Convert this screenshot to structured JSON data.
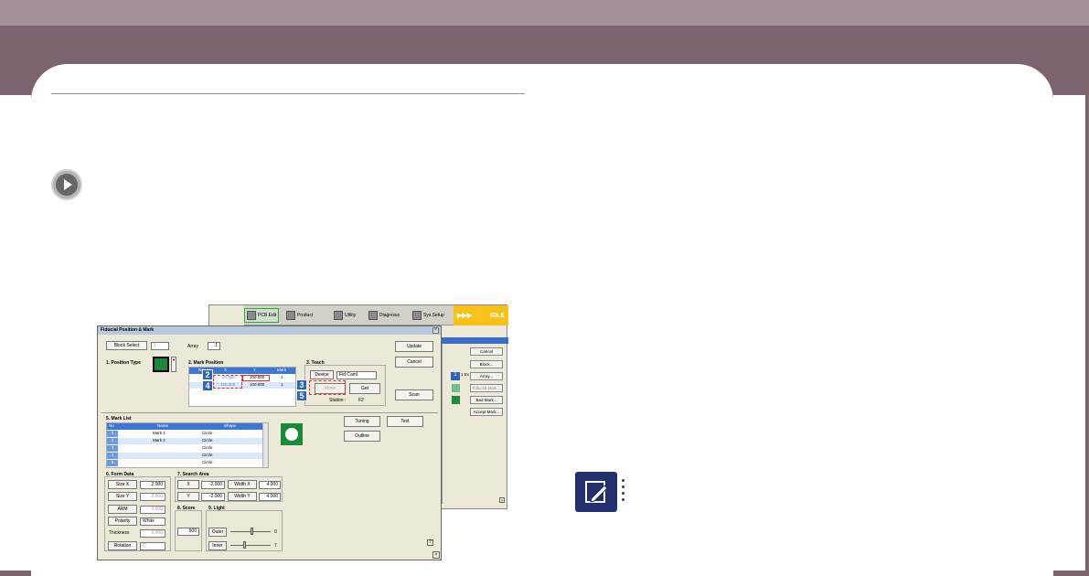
{
  "screenshot": {
    "toolbar": {
      "items": [
        {
          "label": "PCB Edit",
          "icon": "pcb-edit-icon"
        },
        {
          "label": "Product",
          "icon": "product-icon"
        },
        {
          "label": "Utility",
          "icon": "utility-icon"
        },
        {
          "label": "Diagnosis",
          "icon": "diagnosis-icon"
        },
        {
          "label": "Sys.Setup",
          "icon": "sys-setup-icon"
        }
      ],
      "status": "IDLE",
      "status_arrows": "▶▶▶"
    },
    "bg_panel": {
      "buttons": [
        "Cancel",
        "Block...",
        "Array...",
        "Fiducial Mark...",
        "Bad Mark...",
        "Accept Mark..."
      ],
      "index_label": "1",
      "index_value": "1 Ex"
    },
    "dialog": {
      "title": "Fiducial Position & Mark",
      "block_select_label": "Block Select",
      "block_select_value": "1",
      "array_label": "Array",
      "array_value": "1",
      "update_label": "Update",
      "cancel_label": "Cancel",
      "scan_label": "Scan",
      "position_type_label": "1. Position Type",
      "mark_position": {
        "title": "2. Mark Position",
        "columns": [
          "No",
          "X",
          "Y",
          "Mark"
        ],
        "rows": [
          {
            "no": "1",
            "x": "10.000",
            "y": "100.000",
            "mark": "1"
          },
          {
            "no": "2",
            "x": "150.000",
            "y": "100.000",
            "mark": "1"
          }
        ]
      },
      "teach": {
        "title": "3. Teach",
        "device_label": "Device",
        "device_value": "Fid Caml",
        "move_label": "Move",
        "get_label": "Get",
        "station_label": "Station :",
        "station_value": "F2"
      },
      "callouts": [
        "2",
        "4",
        "3",
        "5"
      ],
      "mark_list": {
        "title": "5. Mark List",
        "columns": [
          "No",
          "Name",
          "Shape"
        ],
        "rows": [
          {
            "no": "1",
            "name": "Mark 1",
            "shape": "Circle"
          },
          {
            "no": "2",
            "name": "Mark 2",
            "shape": "Circle"
          },
          {
            "no": "3",
            "name": "",
            "shape": "Circle"
          },
          {
            "no": "4",
            "name": "",
            "shape": "Circle"
          },
          {
            "no": "5",
            "name": "",
            "shape": "Circle"
          }
        ]
      },
      "tuning_label": "Tuning",
      "test_label": "Test",
      "outline_label": "Outline",
      "form_data": {
        "title": "6. Form Data",
        "size_x_label": "Size X",
        "size_x": "2.000",
        "size_y_label": "Size Y",
        "size_y": "2.000",
        "arm_label": "ARM",
        "arm": "0.000",
        "polarity_label": "Polarity",
        "polarity": "White",
        "thickness_label": "Thickness",
        "thickness": "0.000",
        "rotation_label": "Rotation",
        "rotation": "0"
      },
      "search_area": {
        "title": "7. Search Area",
        "x_label": "X",
        "x": "-2.000",
        "y_label": "Y",
        "y": "-2.000",
        "width_x_label": "Width X",
        "width_x": "4.000",
        "width_y_label": "Width Y",
        "width_y": "4.000"
      },
      "score": {
        "title": "8. Score",
        "value": "500"
      },
      "light": {
        "title": "9. Light",
        "outer_label": "Outer",
        "outer": "0",
        "inner_label": "Inner",
        "inner": "7"
      },
      "help_label": "?"
    }
  }
}
